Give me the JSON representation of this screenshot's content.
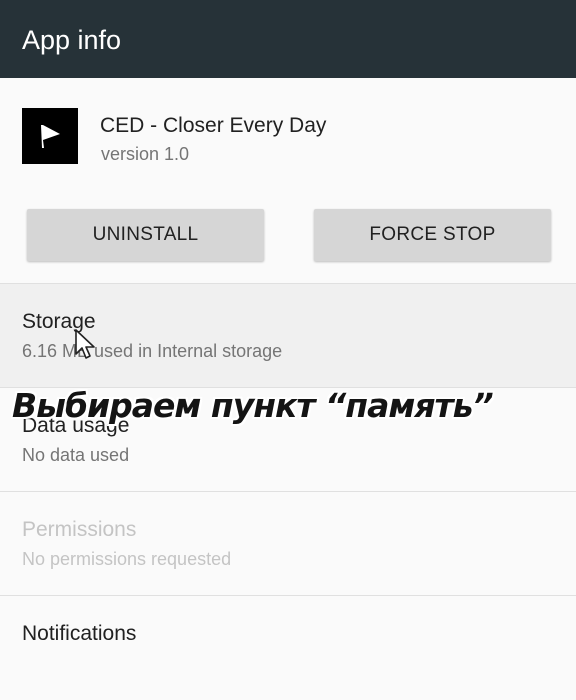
{
  "appbar": {
    "title": "App info"
  },
  "app": {
    "name": "CED - Closer Every Day",
    "version": "version 1.0",
    "icon": "play-flag-icon"
  },
  "buttons": {
    "uninstall": "UNINSTALL",
    "force_stop": "FORCE STOP"
  },
  "items": [
    {
      "title": "Storage",
      "subtitle": "6.16 MB used in Internal storage"
    },
    {
      "title": "Data usage",
      "subtitle": "No data used"
    },
    {
      "title": "Permissions",
      "subtitle": "No permissions requested",
      "disabled": true
    },
    {
      "title": "Notifications",
      "subtitle": ""
    }
  ],
  "overlay_caption": "Выбираем пункт “память”",
  "colors": {
    "appbar": "#263238",
    "button": "#d6d6d6",
    "disabled_text": "#c4c4c4"
  }
}
